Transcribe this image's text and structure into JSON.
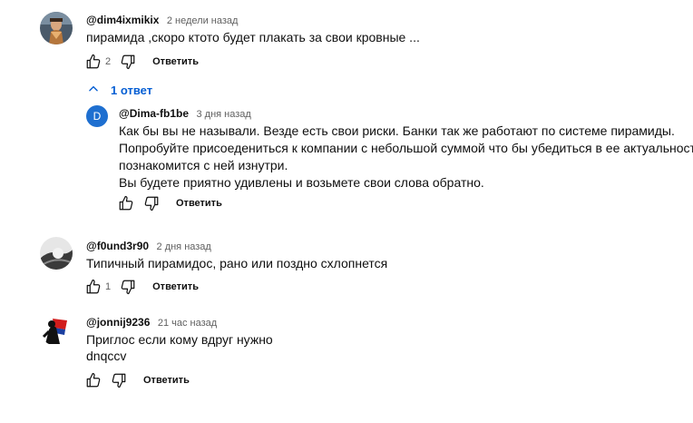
{
  "comments": [
    {
      "author": "@dim4ixmikix",
      "time": "2 недели назад",
      "text": "пирамида ,скоро ктото будет плакать за свои кровные ...",
      "likes": "2",
      "reply_label": "Ответить",
      "replies_toggle": "1 ответ",
      "replies": [
        {
          "author": "@Dima-fb1be",
          "avatar_letter": "D",
          "time": "3 дня назад",
          "lines": [
            "Как бы вы не называли. Везде есть свои риски. Банки так же работают по системе пирамиды.",
            "Попробуйте присоедениться к компании с небольшой суммой что бы убедиться в ее актуальности. И",
            "познакомится с ней изнутри.",
            "Вы будете приятно удивлены и возьмете свои слова обратно."
          ],
          "reply_label": "Ответить"
        }
      ]
    },
    {
      "author": "@f0und3r90",
      "time": "2 дня назад",
      "text": "Типичный пирамидос, рано или поздно схлопнется",
      "likes": "1",
      "reply_label": "Ответить"
    },
    {
      "author": "@jonnij9236",
      "time": "21 час назад",
      "lines": [
        "Приглос если кому вдруг нужно",
        "dnqccv"
      ],
      "reply_label": "Ответить"
    }
  ],
  "colors": {
    "link": "#065fd4",
    "reply_avatar": "#1e6fd0"
  },
  "icons": [
    "thumb-up-icon",
    "thumb-down-icon",
    "chevron-up-icon"
  ]
}
